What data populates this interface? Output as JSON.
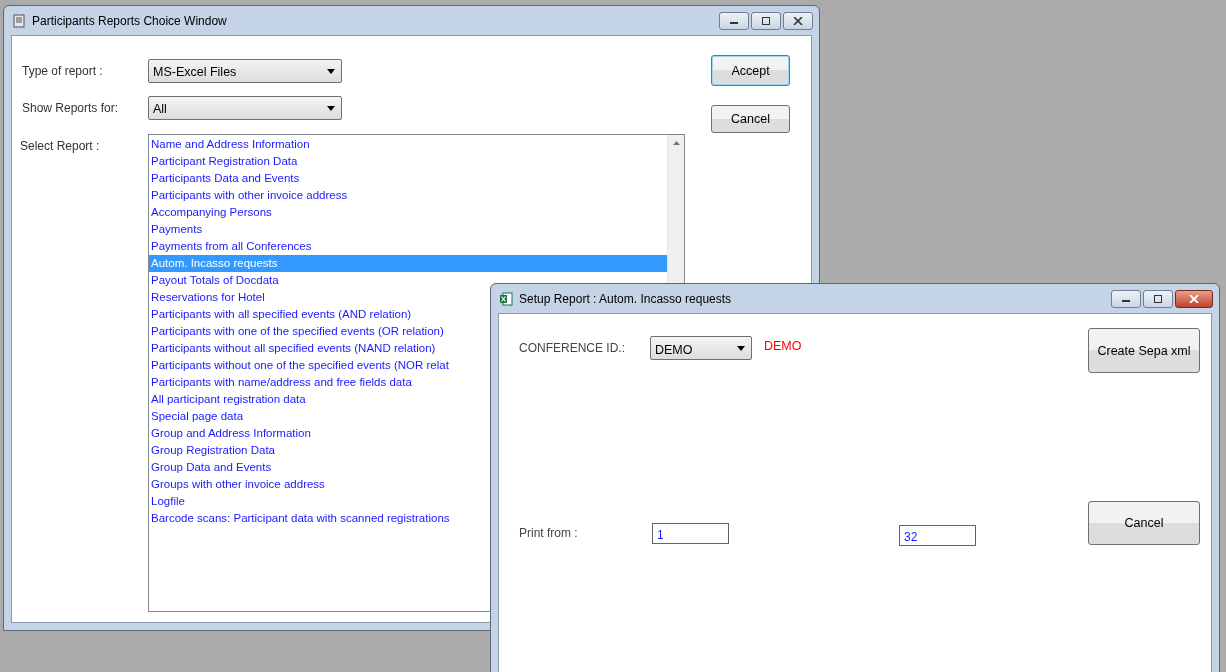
{
  "report_window": {
    "title": "Participants Reports Choice Window",
    "type_of_report": {
      "label": "Type of report :",
      "value": "MS-Excel Files"
    },
    "show_reports_for": {
      "label": "Show Reports for:",
      "value": "All"
    },
    "select_report": {
      "label": "Select Report :",
      "items": [
        {
          "label": "Name and Address Information",
          "selected": false
        },
        {
          "label": "Participant Registration Data",
          "selected": false
        },
        {
          "label": "Participants Data and Events",
          "selected": false
        },
        {
          "label": "Participants with other invoice address",
          "selected": false
        },
        {
          "label": "Accompanying Persons",
          "selected": false
        },
        {
          "label": "Payments",
          "selected": false
        },
        {
          "label": "Payments from all Conferences",
          "selected": false
        },
        {
          "label": "Autom. Incasso requests",
          "selected": true
        },
        {
          "label": "Payout Totals of Docdata",
          "selected": false
        },
        {
          "label": "Reservations for Hotel",
          "selected": false
        },
        {
          "label": "Participants with all specified events (AND relation)",
          "selected": false
        },
        {
          "label": "Participants with one of the specified events (OR relation)",
          "selected": false
        },
        {
          "label": "Participants without all specified events (NAND relation)",
          "selected": false
        },
        {
          "label": "Participants without one of the specified events (NOR relat",
          "selected": false
        },
        {
          "label": "Participants with name/address and free fields data",
          "selected": false
        },
        {
          "label": "All participant registration data",
          "selected": false
        },
        {
          "label": "Special page data",
          "selected": false
        },
        {
          "label": "Group and Address Information",
          "selected": false
        },
        {
          "label": "Group Registration Data",
          "selected": false
        },
        {
          "label": "Group Data and Events",
          "selected": false
        },
        {
          "label": "Groups with other invoice address",
          "selected": false
        },
        {
          "label": "Logfile",
          "selected": false
        },
        {
          "label": "Barcode scans: Participant data with scanned registrations",
          "selected": false
        }
      ]
    },
    "buttons": [
      "Accept",
      "Cancel"
    ]
  },
  "setup_window": {
    "title": "Setup Report : Autom. Incasso requests",
    "conference_id": {
      "label": "CONFERENCE ID.:",
      "value": "DEMO",
      "display": "DEMO"
    },
    "create_button": "Create Sepa xml",
    "print_from": {
      "label": "Print from :",
      "from": "1",
      "to": "32"
    },
    "cancel_button": "Cancel"
  }
}
